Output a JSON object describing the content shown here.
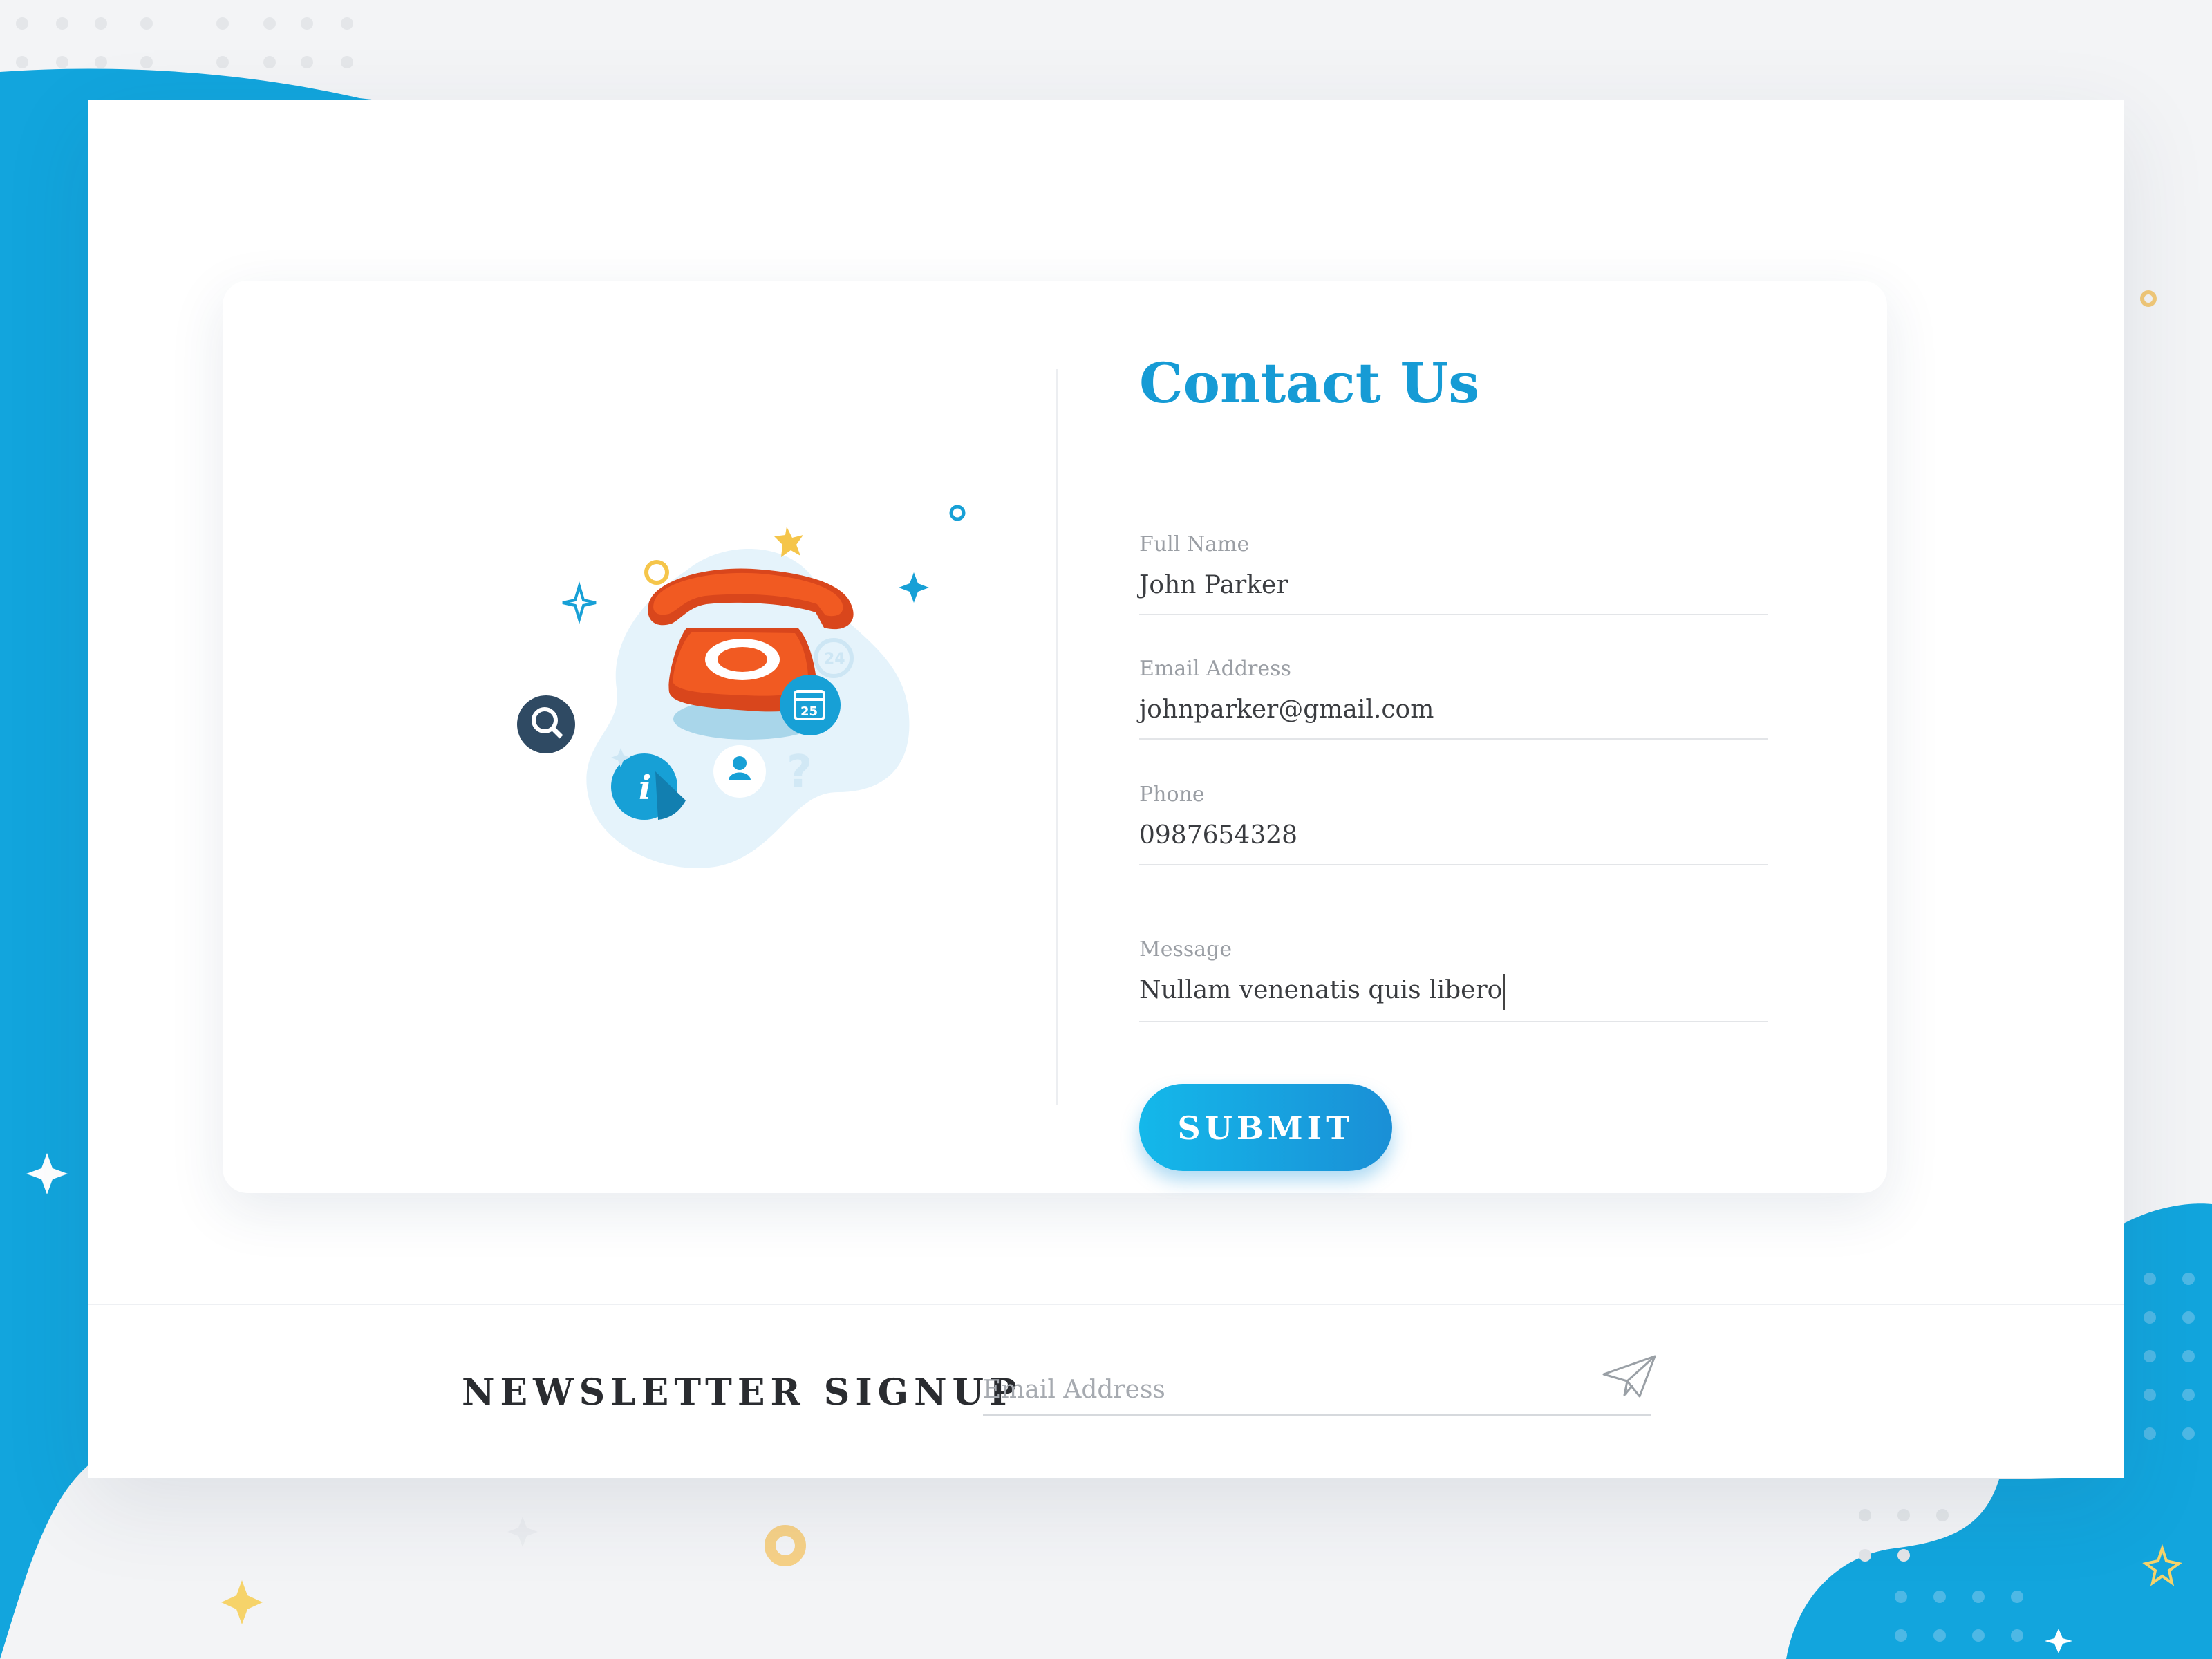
{
  "colors": {
    "brand_blue": "#12a5dd",
    "accent_yellow": "#f5c54a",
    "phone_orange": "#f15a22"
  },
  "contact_form": {
    "title": "Contact Us",
    "fields": [
      {
        "label": "Full Name",
        "value": "John Parker"
      },
      {
        "label": "Email Address",
        "value": "johnparker@gmail.com"
      },
      {
        "label": "Phone",
        "value": "0987654328"
      },
      {
        "label": "Message",
        "value": "Nullam venenatis quis libero"
      }
    ],
    "submit_label": "SUBMIT"
  },
  "illustration": {
    "icons": [
      "telephone-icon",
      "gear-search-icon",
      "info-icon",
      "calendar-icon",
      "user-pin-icon",
      "clock-24-icon",
      "question-icon"
    ],
    "calendar_day": "25",
    "clock_label": "24"
  },
  "newsletter": {
    "title": "NEWSLETTER SIGNUP",
    "placeholder": "Email Address",
    "send_icon": "paper-plane-icon"
  }
}
